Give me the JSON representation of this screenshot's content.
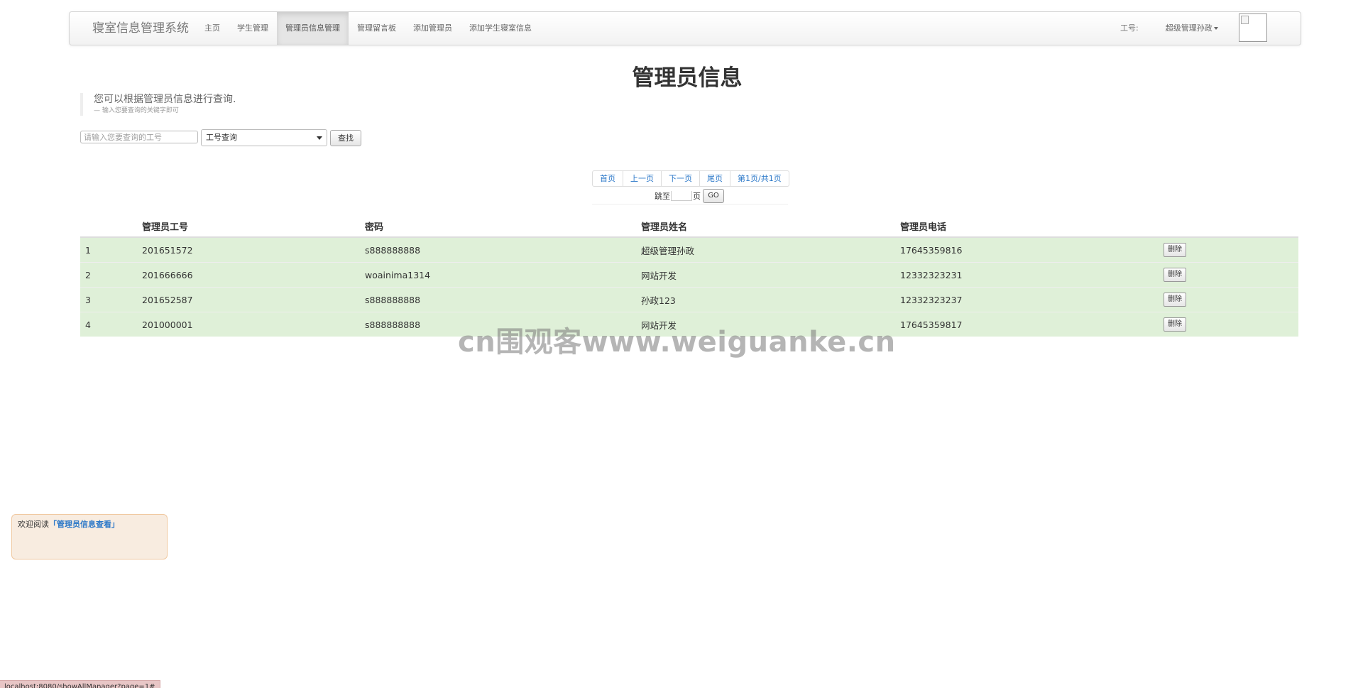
{
  "navbar": {
    "brand": "寝室信息管理系统",
    "items": [
      {
        "label": "主页",
        "active": false
      },
      {
        "label": "学生管理",
        "active": false
      },
      {
        "label": "管理员信息管理",
        "active": true
      },
      {
        "label": "管理留言板",
        "active": false
      },
      {
        "label": "添加管理员",
        "active": false
      },
      {
        "label": "添加学生寝室信息",
        "active": false
      }
    ],
    "id_label": "工号:",
    "user_name": "超级管理孙政"
  },
  "page": {
    "title": "管理员信息",
    "intro": "您可以根据管理员信息进行查询.",
    "hint": "— 输入您要查询的关键字即可"
  },
  "search": {
    "placeholder": "请输入您要查询的工号",
    "select_value": "工号查询",
    "button_label": "查找"
  },
  "pagination": {
    "first": "首页",
    "prev": "上一页",
    "next": "下一页",
    "last": "尾页",
    "info": "第1页/共1页",
    "jump_prefix": "跳至",
    "jump_suffix": "页",
    "go_label": "GO"
  },
  "table": {
    "headers": [
      "",
      "管理员工号",
      "密码",
      "管理员姓名",
      "管理员电话",
      ""
    ],
    "delete_label": "删除",
    "rows": [
      {
        "index": "1",
        "id": "201651572",
        "password": "s888888888",
        "name": "超级管理孙政",
        "phone": "17645359816"
      },
      {
        "index": "2",
        "id": "201666666",
        "password": "woainima1314",
        "name": "网站开发",
        "phone": "12332323231"
      },
      {
        "index": "3",
        "id": "201652587",
        "password": "s888888888",
        "name": "孙政123",
        "phone": "12332323237"
      },
      {
        "index": "4",
        "id": "201000001",
        "password": "s888888888",
        "name": "网站开发",
        "phone": "17645359817"
      }
    ]
  },
  "watermark": "cn围观客www.weiguanke.cn",
  "welcome": {
    "prefix": "欢迎阅读",
    "link": "「管理员信息查看」"
  },
  "status_url": "localhost:8080/showAllManager?page=1#"
}
